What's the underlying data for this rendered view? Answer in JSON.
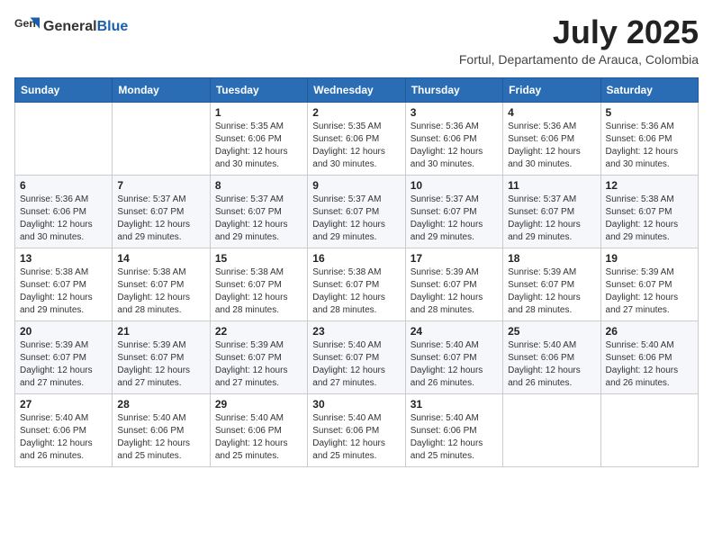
{
  "logo": {
    "general": "General",
    "blue": "Blue"
  },
  "title": {
    "month_year": "July 2025",
    "location": "Fortul, Departamento de Arauca, Colombia"
  },
  "weekdays": [
    "Sunday",
    "Monday",
    "Tuesday",
    "Wednesday",
    "Thursday",
    "Friday",
    "Saturday"
  ],
  "weeks": [
    [
      {
        "day": "",
        "sunrise": "",
        "sunset": "",
        "daylight": ""
      },
      {
        "day": "",
        "sunrise": "",
        "sunset": "",
        "daylight": ""
      },
      {
        "day": "1",
        "sunrise": "Sunrise: 5:35 AM",
        "sunset": "Sunset: 6:06 PM",
        "daylight": "Daylight: 12 hours and 30 minutes."
      },
      {
        "day": "2",
        "sunrise": "Sunrise: 5:35 AM",
        "sunset": "Sunset: 6:06 PM",
        "daylight": "Daylight: 12 hours and 30 minutes."
      },
      {
        "day": "3",
        "sunrise": "Sunrise: 5:36 AM",
        "sunset": "Sunset: 6:06 PM",
        "daylight": "Daylight: 12 hours and 30 minutes."
      },
      {
        "day": "4",
        "sunrise": "Sunrise: 5:36 AM",
        "sunset": "Sunset: 6:06 PM",
        "daylight": "Daylight: 12 hours and 30 minutes."
      },
      {
        "day": "5",
        "sunrise": "Sunrise: 5:36 AM",
        "sunset": "Sunset: 6:06 PM",
        "daylight": "Daylight: 12 hours and 30 minutes."
      }
    ],
    [
      {
        "day": "6",
        "sunrise": "Sunrise: 5:36 AM",
        "sunset": "Sunset: 6:06 PM",
        "daylight": "Daylight: 12 hours and 30 minutes."
      },
      {
        "day": "7",
        "sunrise": "Sunrise: 5:37 AM",
        "sunset": "Sunset: 6:07 PM",
        "daylight": "Daylight: 12 hours and 29 minutes."
      },
      {
        "day": "8",
        "sunrise": "Sunrise: 5:37 AM",
        "sunset": "Sunset: 6:07 PM",
        "daylight": "Daylight: 12 hours and 29 minutes."
      },
      {
        "day": "9",
        "sunrise": "Sunrise: 5:37 AM",
        "sunset": "Sunset: 6:07 PM",
        "daylight": "Daylight: 12 hours and 29 minutes."
      },
      {
        "day": "10",
        "sunrise": "Sunrise: 5:37 AM",
        "sunset": "Sunset: 6:07 PM",
        "daylight": "Daylight: 12 hours and 29 minutes."
      },
      {
        "day": "11",
        "sunrise": "Sunrise: 5:37 AM",
        "sunset": "Sunset: 6:07 PM",
        "daylight": "Daylight: 12 hours and 29 minutes."
      },
      {
        "day": "12",
        "sunrise": "Sunrise: 5:38 AM",
        "sunset": "Sunset: 6:07 PM",
        "daylight": "Daylight: 12 hours and 29 minutes."
      }
    ],
    [
      {
        "day": "13",
        "sunrise": "Sunrise: 5:38 AM",
        "sunset": "Sunset: 6:07 PM",
        "daylight": "Daylight: 12 hours and 29 minutes."
      },
      {
        "day": "14",
        "sunrise": "Sunrise: 5:38 AM",
        "sunset": "Sunset: 6:07 PM",
        "daylight": "Daylight: 12 hours and 28 minutes."
      },
      {
        "day": "15",
        "sunrise": "Sunrise: 5:38 AM",
        "sunset": "Sunset: 6:07 PM",
        "daylight": "Daylight: 12 hours and 28 minutes."
      },
      {
        "day": "16",
        "sunrise": "Sunrise: 5:38 AM",
        "sunset": "Sunset: 6:07 PM",
        "daylight": "Daylight: 12 hours and 28 minutes."
      },
      {
        "day": "17",
        "sunrise": "Sunrise: 5:39 AM",
        "sunset": "Sunset: 6:07 PM",
        "daylight": "Daylight: 12 hours and 28 minutes."
      },
      {
        "day": "18",
        "sunrise": "Sunrise: 5:39 AM",
        "sunset": "Sunset: 6:07 PM",
        "daylight": "Daylight: 12 hours and 28 minutes."
      },
      {
        "day": "19",
        "sunrise": "Sunrise: 5:39 AM",
        "sunset": "Sunset: 6:07 PM",
        "daylight": "Daylight: 12 hours and 27 minutes."
      }
    ],
    [
      {
        "day": "20",
        "sunrise": "Sunrise: 5:39 AM",
        "sunset": "Sunset: 6:07 PM",
        "daylight": "Daylight: 12 hours and 27 minutes."
      },
      {
        "day": "21",
        "sunrise": "Sunrise: 5:39 AM",
        "sunset": "Sunset: 6:07 PM",
        "daylight": "Daylight: 12 hours and 27 minutes."
      },
      {
        "day": "22",
        "sunrise": "Sunrise: 5:39 AM",
        "sunset": "Sunset: 6:07 PM",
        "daylight": "Daylight: 12 hours and 27 minutes."
      },
      {
        "day": "23",
        "sunrise": "Sunrise: 5:40 AM",
        "sunset": "Sunset: 6:07 PM",
        "daylight": "Daylight: 12 hours and 27 minutes."
      },
      {
        "day": "24",
        "sunrise": "Sunrise: 5:40 AM",
        "sunset": "Sunset: 6:07 PM",
        "daylight": "Daylight: 12 hours and 26 minutes."
      },
      {
        "day": "25",
        "sunrise": "Sunrise: 5:40 AM",
        "sunset": "Sunset: 6:06 PM",
        "daylight": "Daylight: 12 hours and 26 minutes."
      },
      {
        "day": "26",
        "sunrise": "Sunrise: 5:40 AM",
        "sunset": "Sunset: 6:06 PM",
        "daylight": "Daylight: 12 hours and 26 minutes."
      }
    ],
    [
      {
        "day": "27",
        "sunrise": "Sunrise: 5:40 AM",
        "sunset": "Sunset: 6:06 PM",
        "daylight": "Daylight: 12 hours and 26 minutes."
      },
      {
        "day": "28",
        "sunrise": "Sunrise: 5:40 AM",
        "sunset": "Sunset: 6:06 PM",
        "daylight": "Daylight: 12 hours and 25 minutes."
      },
      {
        "day": "29",
        "sunrise": "Sunrise: 5:40 AM",
        "sunset": "Sunset: 6:06 PM",
        "daylight": "Daylight: 12 hours and 25 minutes."
      },
      {
        "day": "30",
        "sunrise": "Sunrise: 5:40 AM",
        "sunset": "Sunset: 6:06 PM",
        "daylight": "Daylight: 12 hours and 25 minutes."
      },
      {
        "day": "31",
        "sunrise": "Sunrise: 5:40 AM",
        "sunset": "Sunset: 6:06 PM",
        "daylight": "Daylight: 12 hours and 25 minutes."
      },
      {
        "day": "",
        "sunrise": "",
        "sunset": "",
        "daylight": ""
      },
      {
        "day": "",
        "sunrise": "",
        "sunset": "",
        "daylight": ""
      }
    ]
  ]
}
